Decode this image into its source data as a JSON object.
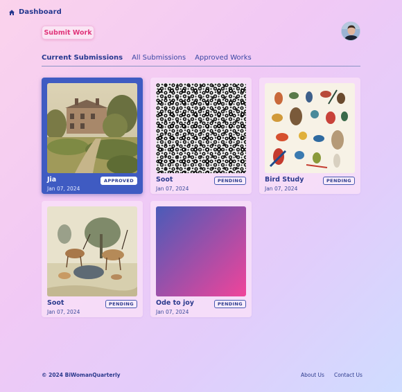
{
  "nav": {
    "dashboard_label": "Dashboard",
    "home_icon": "home-icon"
  },
  "header": {
    "submit_label": "Submit Work",
    "avatar_icon": "user-avatar"
  },
  "tabs": [
    {
      "label": "Current Submissions",
      "active": true
    },
    {
      "label": "All Submissions",
      "active": false
    },
    {
      "label": "Approved Works",
      "active": false
    }
  ],
  "cards": [
    {
      "title": "Jia",
      "date": "Jan 07, 2024",
      "status": "APPROVED",
      "selected": true
    },
    {
      "title": "Soot",
      "date": "Jan 07, 2024",
      "status": "PENDING",
      "selected": false
    },
    {
      "title": "Bird Study",
      "date": "Jan 07, 2024",
      "status": "PENDING",
      "selected": false
    },
    {
      "title": "Soot",
      "date": "Jan 07, 2024",
      "status": "PENDING",
      "selected": false
    },
    {
      "title": "Ode to joy",
      "date": "Jan 07, 2024",
      "status": "PENDING",
      "selected": false
    }
  ],
  "footer": {
    "copyright": "© 2024 BiWomanQuarterly",
    "links": [
      "About Us",
      "Contact Us"
    ]
  },
  "colors": {
    "accent": "#24378e",
    "submit": "#e0357a",
    "selected_card": "#3f5bc2"
  }
}
